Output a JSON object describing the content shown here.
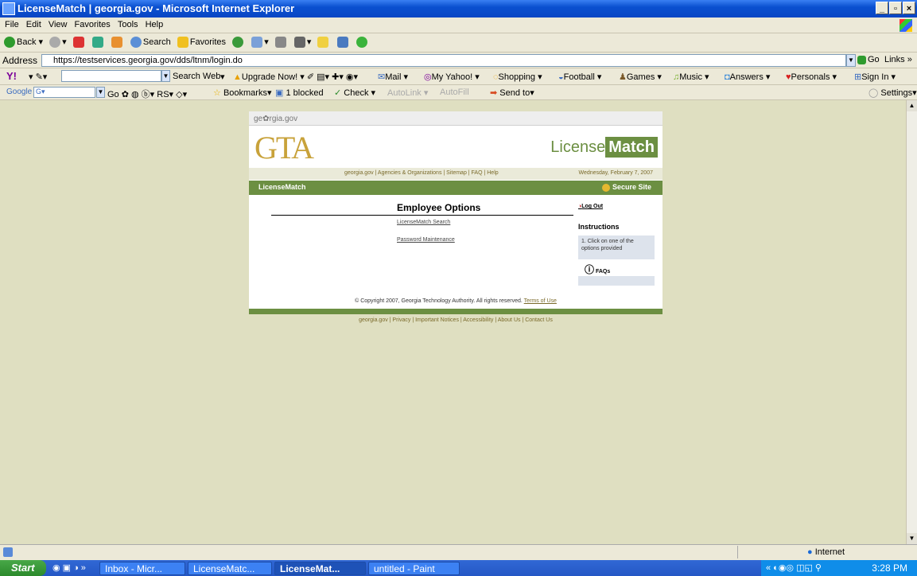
{
  "window": {
    "title": "LicenseMatch | georgia.gov - Microsoft Internet Explorer",
    "controls": [
      "_",
      "▫",
      "×"
    ]
  },
  "menu": [
    "File",
    "Edit",
    "View",
    "Favorites",
    "Tools",
    "Help"
  ],
  "toolbar": {
    "back": "Back",
    "search": "Search",
    "favorites": "Favorites"
  },
  "address": {
    "label": "Address",
    "url": "https://testservices.georgia.gov/dds/ltnm/login.do",
    "go": "Go",
    "links": "Links »"
  },
  "yahoo_bar": {
    "logo": "Y!",
    "search_web": "Search Web",
    "upgrade": "Upgrade Now!",
    "mail": "Mail",
    "my_yahoo": "My Yahoo!",
    "shopping": "Shopping",
    "football": "Football",
    "games": "Games",
    "music": "Music",
    "answers": "Answers",
    "personals": "Personals",
    "sign_in": "Sign In"
  },
  "google_bar": {
    "logo": "Google",
    "go": "Go",
    "bookmarks": "Bookmarks",
    "blocked": "1 blocked",
    "check": "Check",
    "autolink": "AutoLink",
    "autofill": "AutoFill",
    "send_to": "Send to",
    "settings": "Settings"
  },
  "page": {
    "georgia_logo": "ge✿rgia.gov",
    "gta_logo": "GTA",
    "lm_logo_a": "License",
    "lm_logo_b": "Match",
    "top_links": "georgia.gov | Agencies & Organizations | Sitemap | FAQ | Help",
    "date": "Wednesday, February 7, 2007",
    "green_title": "LicenseMatch",
    "secure": "Secure Site",
    "heading": "Employee Options",
    "option1": "LicenseMatch Search",
    "option2": "Password Maintenance",
    "logout": "Log Out",
    "instructions_title": "Instructions",
    "instructions_text": "1. Click on one of the options provided",
    "faqs": "FAQs",
    "copyright": "© Copyright 2007, Georgia Technology Authority. All rights reserved.",
    "terms": "Terms of Use",
    "footer_links": "georgia.gov | Privacy | Important Notices | Accessibility | About Us | Contact Us"
  },
  "status": {
    "zone": "Internet"
  },
  "taskbar": {
    "start": "Start",
    "tasks": [
      "Inbox - Micr...",
      "LicenseMatc...",
      "LicenseMat...",
      "untitled - Paint"
    ],
    "time": "3:28 PM"
  }
}
